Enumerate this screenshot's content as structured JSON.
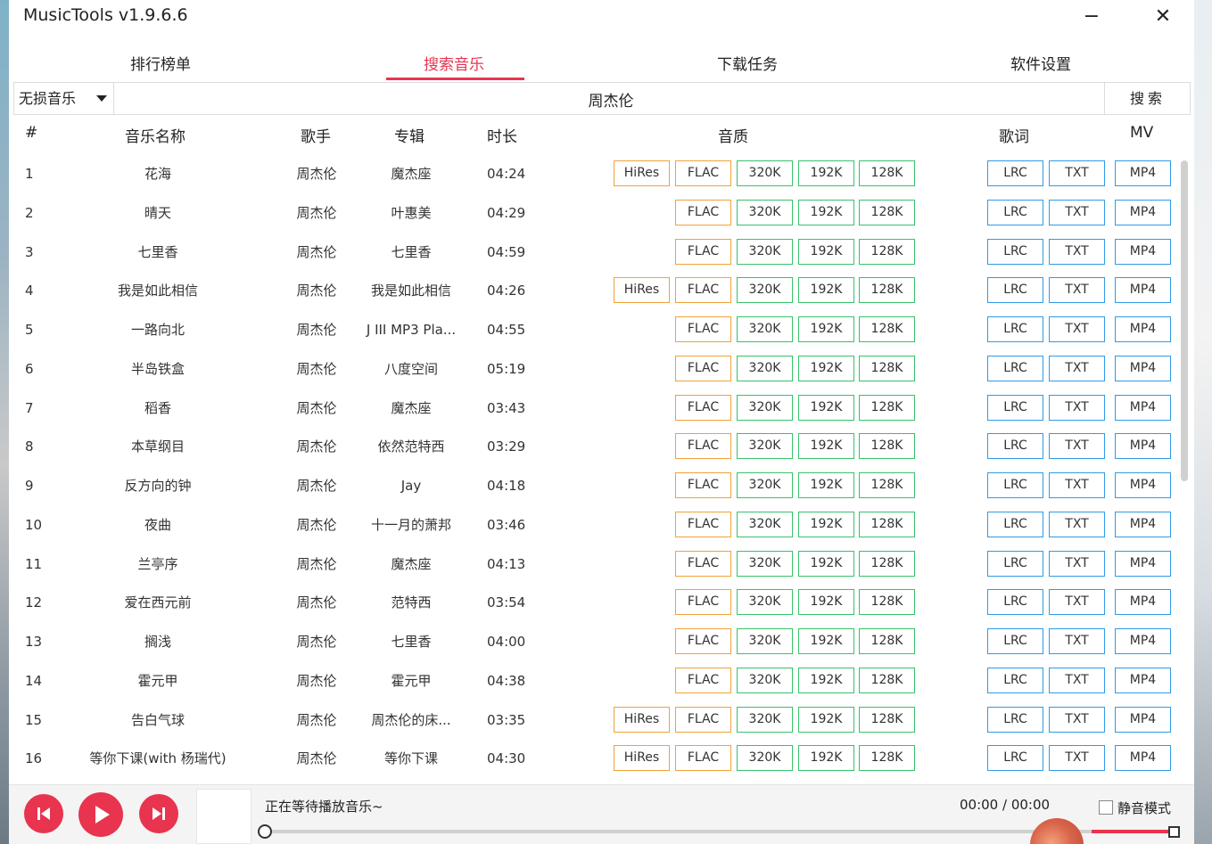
{
  "window": {
    "title": "MusicTools v1.9.6.6",
    "minimize_glyph": "−",
    "close_glyph": "✕"
  },
  "tabs": [
    {
      "label": "排行榜单",
      "active": false
    },
    {
      "label": "搜索音乐",
      "active": true
    },
    {
      "label": "下载任务",
      "active": false
    },
    {
      "label": "软件设置",
      "active": false
    }
  ],
  "accent_color": "#e8344e",
  "search": {
    "source": "无损音乐",
    "query": "周杰伦",
    "button": "搜索"
  },
  "table": {
    "headers": {
      "num": "#",
      "name": "音乐名称",
      "artist": "歌手",
      "album": "专辑",
      "duration": "时长",
      "quality": "音质",
      "lyrics": "歌词",
      "mv": "MV"
    },
    "button_labels": {
      "hires": "HiRes",
      "flac": "FLAC",
      "k320": "320K",
      "k192": "192K",
      "k128": "128K",
      "lrc": "LRC",
      "txt": "TXT",
      "mp4": "MP4"
    },
    "rows": [
      {
        "num": "1",
        "name": "花海",
        "artist": "周杰伦",
        "album": "魔杰座",
        "duration": "04:24",
        "hires": true
      },
      {
        "num": "2",
        "name": "晴天",
        "artist": "周杰伦",
        "album": "叶惠美",
        "duration": "04:29",
        "hires": false
      },
      {
        "num": "3",
        "name": "七里香",
        "artist": "周杰伦",
        "album": "七里香",
        "duration": "04:59",
        "hires": false
      },
      {
        "num": "4",
        "name": "我是如此相信",
        "artist": "周杰伦",
        "album": "我是如此相信",
        "duration": "04:26",
        "hires": true
      },
      {
        "num": "5",
        "name": "一路向北",
        "artist": "周杰伦",
        "album": "J III MP3 Pla...",
        "duration": "04:55",
        "hires": false
      },
      {
        "num": "6",
        "name": "半岛铁盒",
        "artist": "周杰伦",
        "album": "八度空间",
        "duration": "05:19",
        "hires": false
      },
      {
        "num": "7",
        "name": "稻香",
        "artist": "周杰伦",
        "album": "魔杰座",
        "duration": "03:43",
        "hires": false
      },
      {
        "num": "8",
        "name": "本草纲目",
        "artist": "周杰伦",
        "album": "依然范特西",
        "duration": "03:29",
        "hires": false
      },
      {
        "num": "9",
        "name": "反方向的钟",
        "artist": "周杰伦",
        "album": "Jay",
        "duration": "04:18",
        "hires": false
      },
      {
        "num": "10",
        "name": "夜曲",
        "artist": "周杰伦",
        "album": "十一月的萧邦",
        "duration": "03:46",
        "hires": false
      },
      {
        "num": "11",
        "name": "兰亭序",
        "artist": "周杰伦",
        "album": "魔杰座",
        "duration": "04:13",
        "hires": false
      },
      {
        "num": "12",
        "name": "爱在西元前",
        "artist": "周杰伦",
        "album": "范特西",
        "duration": "03:54",
        "hires": false
      },
      {
        "num": "13",
        "name": "搁浅",
        "artist": "周杰伦",
        "album": "七里香",
        "duration": "04:00",
        "hires": false
      },
      {
        "num": "14",
        "name": "霍元甲",
        "artist": "周杰伦",
        "album": "霍元甲",
        "duration": "04:38",
        "hires": false
      },
      {
        "num": "15",
        "name": "告白气球",
        "artist": "周杰伦",
        "album": "周杰伦的床...",
        "duration": "03:35",
        "hires": true
      },
      {
        "num": "16",
        "name": "等你下课(with 杨瑞代)",
        "artist": "周杰伦",
        "album": "等你下课",
        "duration": "04:30",
        "hires": true
      }
    ]
  },
  "player": {
    "status": "正在等待播放音乐~",
    "time": "00:00 / 00:00",
    "mute_label": "静音模式",
    "mute_checked": false,
    "progress": 0,
    "volume": 1.0,
    "icons": {
      "prev": "skip-previous-icon",
      "play": "play-icon",
      "next": "skip-next-icon"
    }
  }
}
